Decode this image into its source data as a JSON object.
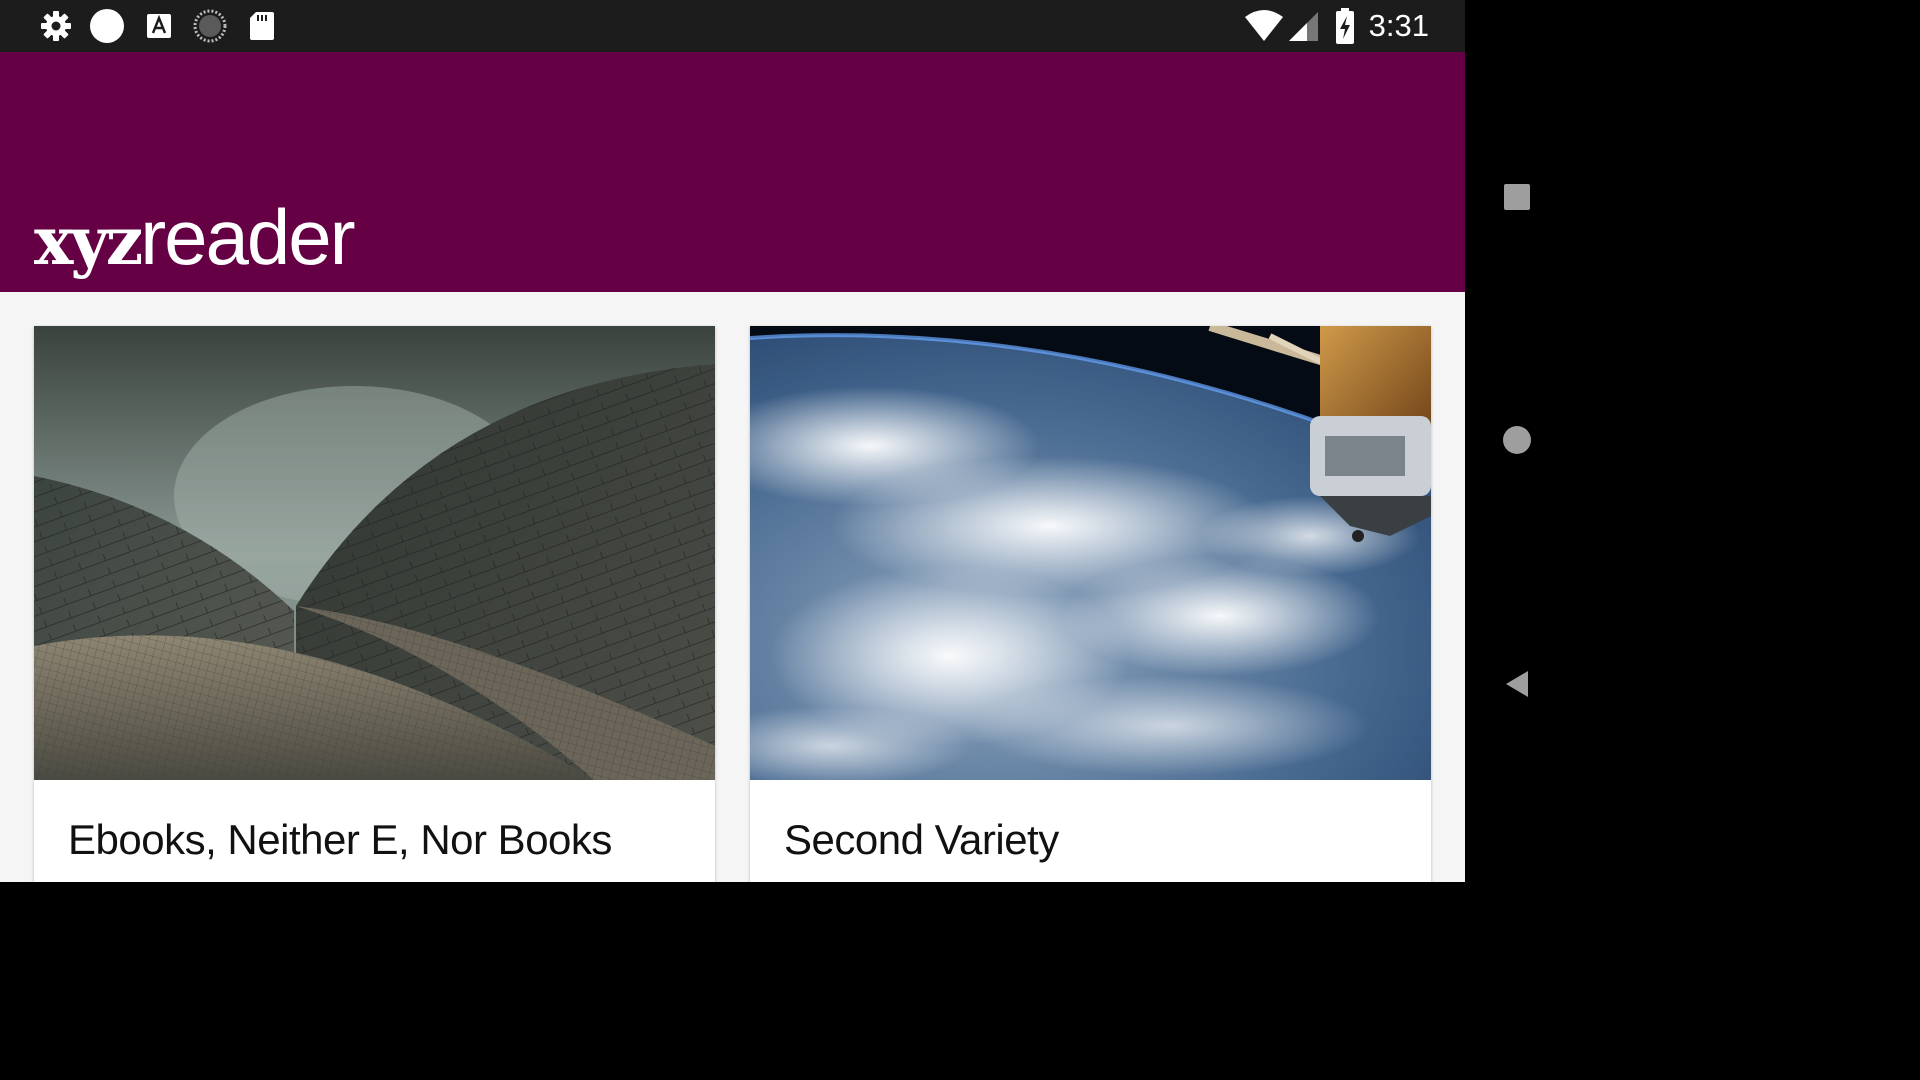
{
  "status_bar": {
    "time": "3:31",
    "left_icons": [
      "gear-icon",
      "circle-icon",
      "text-a-icon",
      "loading-icon",
      "sd-card-icon"
    ],
    "right_icons": [
      "wifi-icon",
      "cell-signal-icon",
      "battery-charging-icon"
    ]
  },
  "app_bar": {
    "logo_bold": "xyz",
    "logo_light": "reader",
    "background": "#660044"
  },
  "articles": [
    {
      "title": "Ebooks, Neither E, Nor Books",
      "image": "opera-house-shells"
    },
    {
      "title": "Second Variety",
      "image": "earth-from-orbit"
    }
  ],
  "nav_bar": {
    "buttons": [
      "recents-button",
      "home-button",
      "back-button"
    ]
  }
}
